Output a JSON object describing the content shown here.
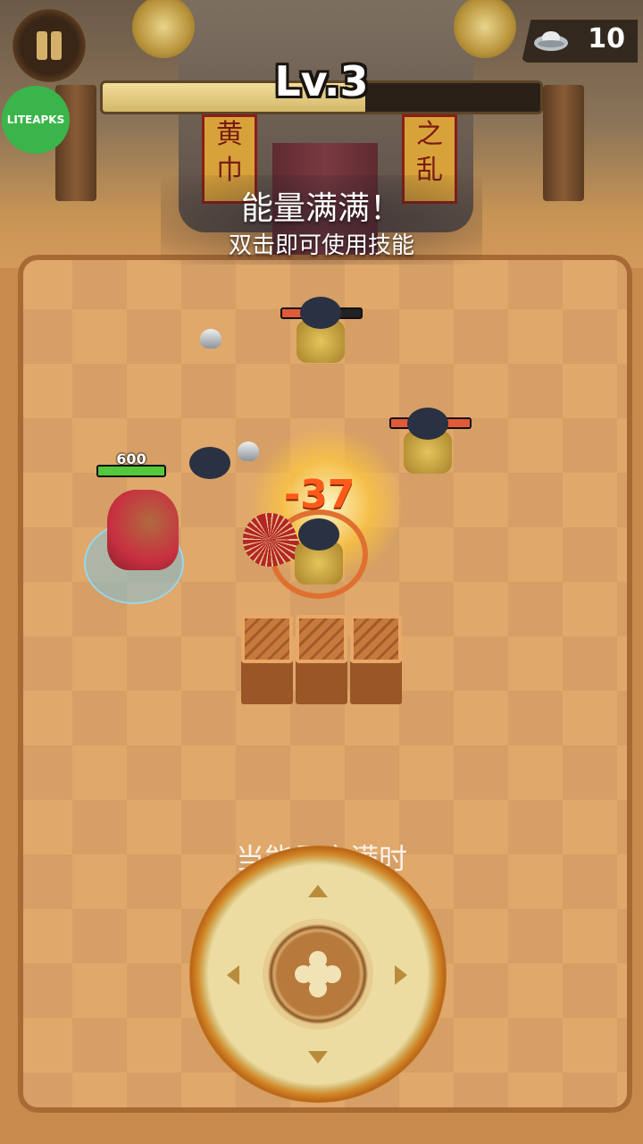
{
  "hud": {
    "level_label": "Lv.3",
    "level_progress": 0.6,
    "currency_icon": "silver-ingot-icon",
    "currency_amount": "10",
    "pause_icon": "pause-icon"
  },
  "banners": {
    "left": "黄巾",
    "right": "之乱"
  },
  "watermark": "LITEAPKS",
  "message": {
    "title": "能量满满！",
    "subtitle": "双击即可使用技能"
  },
  "player": {
    "hp_value": "600",
    "hp_fraction": 1.0
  },
  "enemies": [
    {
      "name": "enemy-top",
      "hp_fraction": 0.6
    },
    {
      "name": "enemy-right",
      "hp_fraction": 1.0
    }
  ],
  "combat": {
    "damage_text": "-37"
  },
  "joystick": {
    "hint_text": "当能量充满时"
  },
  "colors": {
    "player_hp": "#52c83a",
    "enemy_hp": "#e05a3a",
    "damage": "#ff5a1a"
  }
}
